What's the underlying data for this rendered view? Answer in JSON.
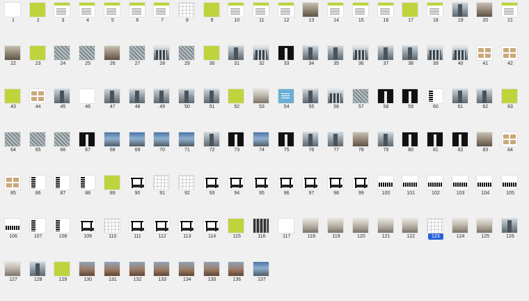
{
  "page_numbers": [
    "1",
    "2",
    "3",
    "4",
    "5",
    "6",
    "7",
    "8",
    "9",
    "10",
    "11",
    "12",
    "13",
    "14",
    "15",
    "16",
    "17",
    "18",
    "19",
    "20",
    "21",
    "22",
    "23",
    "24",
    "25",
    "26",
    "27",
    "28",
    "29",
    "30",
    "31",
    "32",
    "33",
    "34",
    "35",
    "36",
    "37",
    "38",
    "39",
    "40",
    "41",
    "42",
    "43",
    "44",
    "45",
    "46",
    "47",
    "48",
    "49",
    "50",
    "51",
    "52",
    "53",
    "54",
    "55",
    "56",
    "57",
    "58",
    "59",
    "60",
    "61",
    "62",
    "63",
    "64",
    "65",
    "66",
    "67",
    "68",
    "69",
    "70",
    "71",
    "72",
    "73",
    "74",
    "75",
    "76",
    "77",
    "78",
    "79",
    "80",
    "81",
    "82",
    "83",
    "84",
    "85",
    "86",
    "87",
    "88",
    "89",
    "90",
    "91",
    "92",
    "93",
    "94",
    "95",
    "96",
    "97",
    "98",
    "99",
    "100",
    "101",
    "102",
    "103",
    "104",
    "105",
    "106",
    "107",
    "108",
    "109",
    "110",
    "111",
    "112",
    "113",
    "114",
    "115",
    "116",
    "117",
    "118",
    "119",
    "120",
    "121",
    "122",
    "123",
    "124",
    "125",
    "126",
    "127",
    "128",
    "129",
    "130",
    "131",
    "132",
    "133",
    "134",
    "135",
    "136",
    "137"
  ],
  "selected_page": "123",
  "selection_color": "#2a63d8",
  "accent_green": "#bfd43c",
  "thumb_types": [
    "white",
    "green",
    "doc",
    "doc",
    "doc",
    "doc",
    "doc",
    "sheet",
    "green",
    "doc",
    "doc",
    "doc",
    "photo",
    "doc",
    "doc",
    "doc",
    "green",
    "doc",
    "tower",
    "photo",
    "doc",
    "photo",
    "green",
    "aerial",
    "aerial",
    "photo",
    "aerial",
    "buildings",
    "aerial",
    "green",
    "tower",
    "buildings",
    "dark",
    "tower",
    "tower",
    "buildings",
    "tower",
    "tower",
    "buildings",
    "buildings",
    "grid2",
    "grid2",
    "green",
    "grid2",
    "tower",
    "white",
    "tower",
    "tower",
    "tower",
    "tower",
    "tower",
    "green",
    "interior",
    "blue",
    "tower",
    "buildings",
    "aerial",
    "dark",
    "dark",
    "column",
    "tower",
    "tower",
    "green",
    "aerial",
    "aerial",
    "aerial",
    "dark",
    "sky",
    "sky",
    "sky",
    "sky",
    "tower",
    "dark",
    "sky",
    "dark",
    "tower",
    "tower",
    "photo",
    "tower",
    "dark",
    "dark",
    "dark",
    "photo",
    "grid2",
    "grid2",
    "column",
    "column",
    "column",
    "green",
    "plan",
    "sheet",
    "sheet",
    "plan",
    "plan",
    "plan",
    "plan",
    "plan",
    "plan",
    "plan",
    "elev",
    "elev",
    "elev",
    "elev",
    "elev",
    "elev",
    "elev",
    "column",
    "column",
    "plan",
    "sheet",
    "plan",
    "plan",
    "plan",
    "plan",
    "green",
    "bwphoto",
    "white",
    "interior",
    "interior",
    "interior",
    "interior",
    "interior",
    "sheet",
    "interior",
    "interior",
    "tower",
    "interior",
    "tower",
    "green",
    "street",
    "street",
    "street",
    "street",
    "street",
    "street",
    "street",
    "sky",
    "interior"
  ]
}
